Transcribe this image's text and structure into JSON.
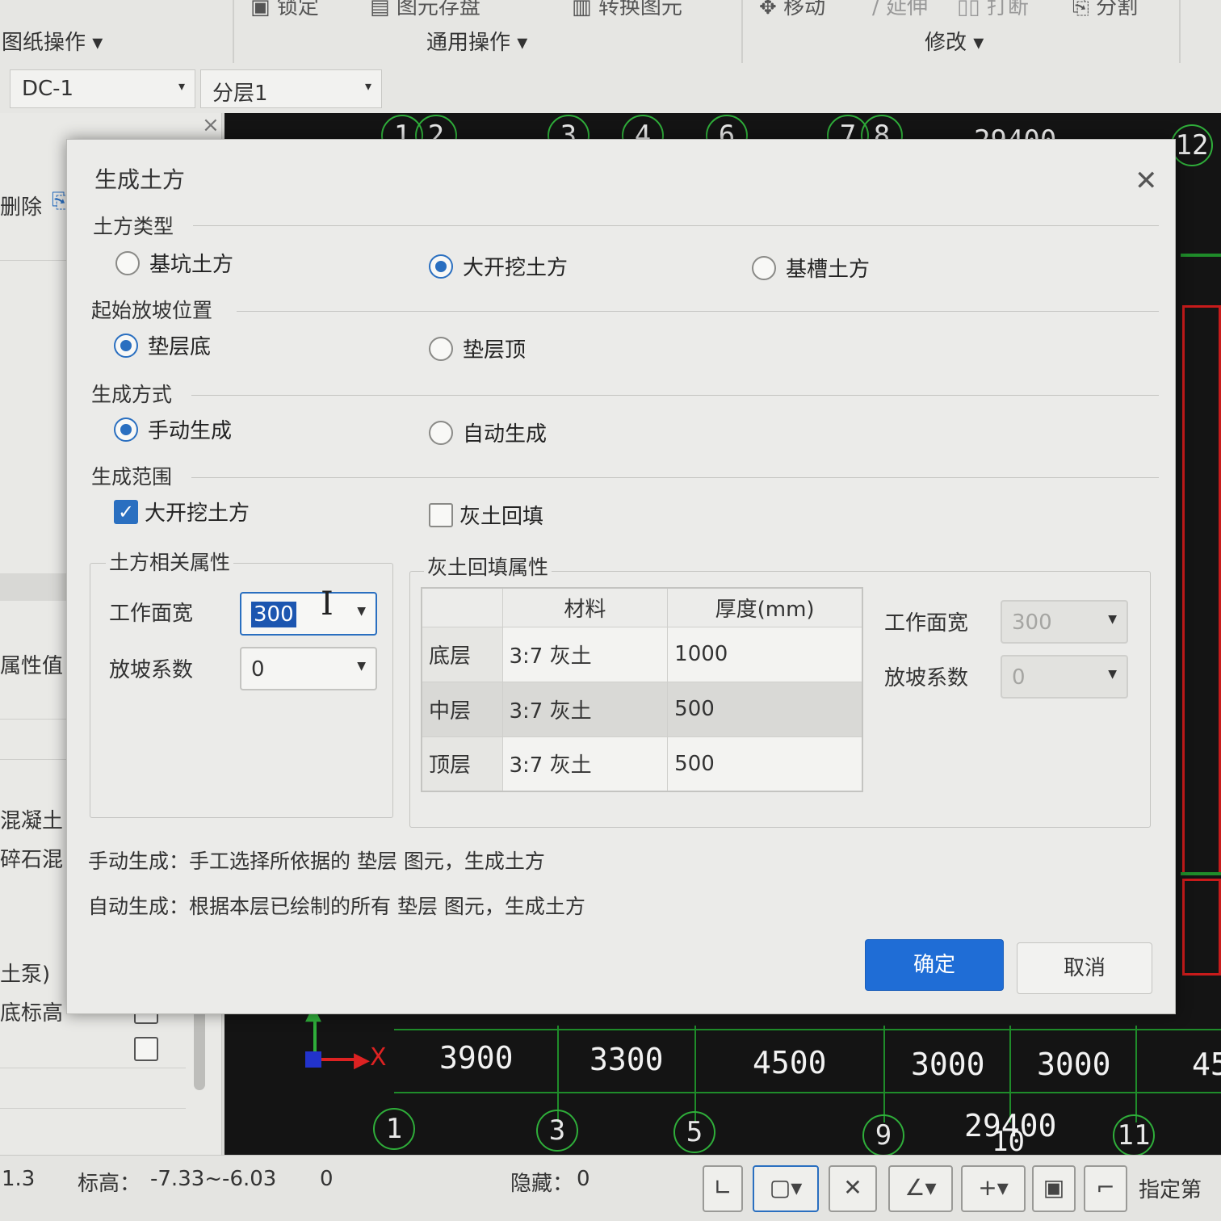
{
  "ribbon": {
    "top_items": [
      "锁定",
      "图元存盘",
      "转换图元",
      "移动",
      "延伸",
      "打断",
      "分割"
    ],
    "groups": [
      "图纸操作",
      "通用操作",
      "修改"
    ],
    "combo1": "DC-1",
    "combo2": "分层1"
  },
  "left_panel": {
    "delete_label": "删除",
    "property_value": "属性值",
    "items": [
      "混凝土",
      "碎石混",
      "土泵)",
      "底标高"
    ]
  },
  "canvas": {
    "top_axes": [
      "1",
      "2",
      "3",
      "4",
      "6",
      "7",
      "8",
      "12"
    ],
    "top_dim": "29400",
    "dims": [
      "3900",
      "3300",
      "4500",
      "3000",
      "3000",
      "45"
    ],
    "bottom_axes": [
      "1",
      "3",
      "5",
      "9",
      "11"
    ],
    "bottom_total": "29400",
    "overlap_label": "10",
    "x_axis": "X"
  },
  "dialog": {
    "title": "生成土方",
    "soil_type": {
      "label": "土方类型",
      "options": [
        "基坑土方",
        "大开挖土方",
        "基槽土方"
      ],
      "selected": "大开挖土方"
    },
    "slope_start": {
      "label": "起始放坡位置",
      "options": [
        "垫层底",
        "垫层顶"
      ],
      "selected": "垫层底"
    },
    "gen_mode": {
      "label": "生成方式",
      "options": [
        "手动生成",
        "自动生成"
      ],
      "selected": "手动生成"
    },
    "gen_range": {
      "label": "生成范围",
      "options": [
        "大开挖土方",
        "灰土回填"
      ],
      "checked": [
        true,
        false
      ]
    },
    "earth_props": {
      "title": "土方相关属性",
      "work_width_label": "工作面宽",
      "work_width_value": "300",
      "slope_label": "放坡系数",
      "slope_value": "0"
    },
    "backfill_props": {
      "title": "灰土回填属性",
      "columns": [
        "",
        "材料",
        "厚度(mm)"
      ],
      "rows": [
        {
          "layer": "底层",
          "material": "3:7 灰土",
          "thickness": "1000"
        },
        {
          "layer": "中层",
          "material": "3:7 灰土",
          "thickness": "500"
        },
        {
          "layer": "顶层",
          "material": "3:7 灰土",
          "thickness": "500"
        }
      ],
      "work_width_label": "工作面宽",
      "work_width_value": "300",
      "slope_label": "放坡系数",
      "slope_value": "0"
    },
    "notes": [
      "手动生成：手工选择所依据的 垫层 图元，生成土方",
      "自动生成：根据本层已绘制的所有 垫层 图元，生成土方"
    ],
    "ok_label": "确定",
    "cancel_label": "取消",
    "accent_color": "#1f6dd6"
  },
  "status": {
    "coord": "1.3",
    "elev_label": "标高：",
    "elev_value": "-7.33~-6.03",
    "count": "0",
    "hidden_label": "隐藏：",
    "hidden_value": "0",
    "right_label": "指定第"
  }
}
